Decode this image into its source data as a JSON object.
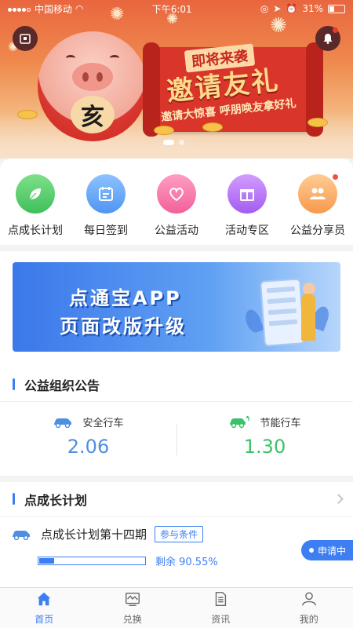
{
  "status_bar": {
    "carrier": "中国移动",
    "time": "下午6:01",
    "battery": "31%",
    "battery_level": 0.31
  },
  "banner": {
    "badge_text": "即将来袭",
    "title": "邀请友礼",
    "subtitle": "邀请大惊喜 呼朋唤友拿好礼",
    "pig_belly_char": "亥",
    "pages": 2,
    "active_page": 0
  },
  "quick_menu": [
    {
      "label": "点成长计划",
      "icon": "leaf-icon",
      "color_from": "#7ee08a",
      "color_to": "#3fbf5a",
      "badge": false
    },
    {
      "label": "每日签到",
      "icon": "calendar-icon",
      "color_from": "#8ec2ff",
      "color_to": "#4f95f2",
      "badge": false
    },
    {
      "label": "公益活动",
      "icon": "heart-icon",
      "color_from": "#ff9ec2",
      "color_to": "#f2609a",
      "badge": false
    },
    {
      "label": "活动专区",
      "icon": "gift-icon",
      "color_from": "#d39cff",
      "color_to": "#a25df0",
      "badge": false
    },
    {
      "label": "公益分享员",
      "icon": "users-icon",
      "color_from": "#ffcc95",
      "color_to": "#f79a4c",
      "badge": true
    }
  ],
  "promo": {
    "line1": "点通宝APP",
    "line2": "页面改版升级"
  },
  "notice": {
    "title": "公益组织公告",
    "stats": [
      {
        "label": "安全行车",
        "value": "2.06",
        "icon": "car-icon",
        "color": "#4f8fe0"
      },
      {
        "label": "节能行车",
        "value": "1.30",
        "icon": "electric-car-icon",
        "color": "#3cc16b"
      }
    ]
  },
  "plan": {
    "title": "点成长计划",
    "item_name": "点成长计划第十四期",
    "tag": "参与条件",
    "status": "申请中",
    "remaining_label": "剩余 90.55%",
    "remaining_fraction": 0.9055
  },
  "tabbar": [
    {
      "label": "首页",
      "icon": "home-icon",
      "active": true
    },
    {
      "label": "兑换",
      "icon": "exchange-icon",
      "active": false
    },
    {
      "label": "资讯",
      "icon": "document-icon",
      "active": false
    },
    {
      "label": "我的",
      "icon": "profile-icon",
      "active": false
    }
  ],
  "colors": {
    "primary": "#3d7ff2",
    "safe_value": "#4f8fe0",
    "eco_value": "#3cc16b"
  }
}
